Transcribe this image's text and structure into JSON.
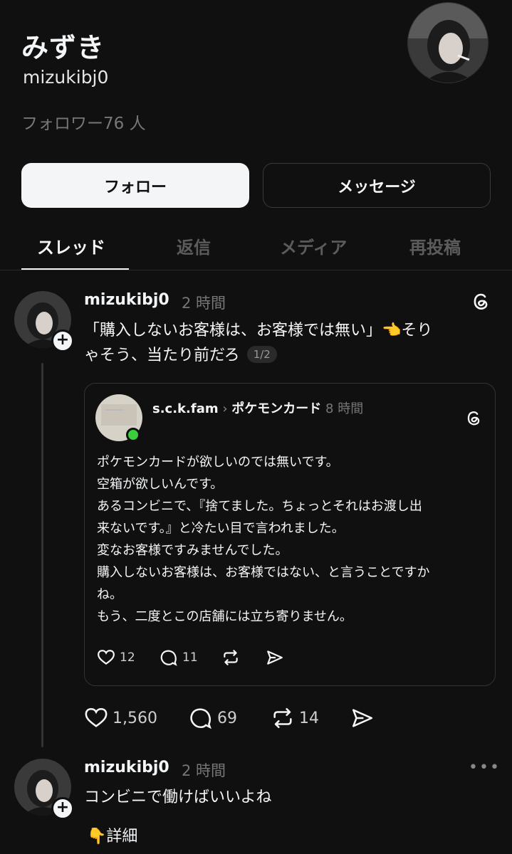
{
  "profile": {
    "name": "みずき",
    "handle": "mizukibj0",
    "followers": "フォロワー76 人"
  },
  "buttons": {
    "follow": "フォロー",
    "message": "メッセージ"
  },
  "tabs": [
    "スレッド",
    "返信",
    "メディア",
    "再投稿"
  ],
  "post1": {
    "username": "mizukibj0",
    "time": "2 時間",
    "line1": "「購入しないお客様は、お客様では無い」👈そり",
    "line2": "ゃそう、当たり前だろ",
    "page_badge": "1/2",
    "likes": "1,560",
    "replies": "69",
    "reposts": "14"
  },
  "quote": {
    "username": "s.c.k.fam",
    "separator": "›",
    "topic": "ポケモンカード",
    "time": "8 時間",
    "lines": [
      "ポケモンカードが欲しいのでは無いです。",
      "空箱が欲しいんです。",
      "あるコンビニで、『捨てました。ちょっとそれはお渡し出",
      "来ないです。』と冷たい目で言われました。",
      "変なお客様ですみませんでした。",
      "購入しないお客様は、お客様ではない、と言うことですか",
      "ね。",
      "もう、二度とこの店舗には立ち寄りません。"
    ],
    "likes": "12",
    "replies": "11"
  },
  "post2": {
    "username": "mizukibj0",
    "time": "2 時間",
    "text": "コンビニで働けばいいよね",
    "detail": "👇詳細"
  }
}
